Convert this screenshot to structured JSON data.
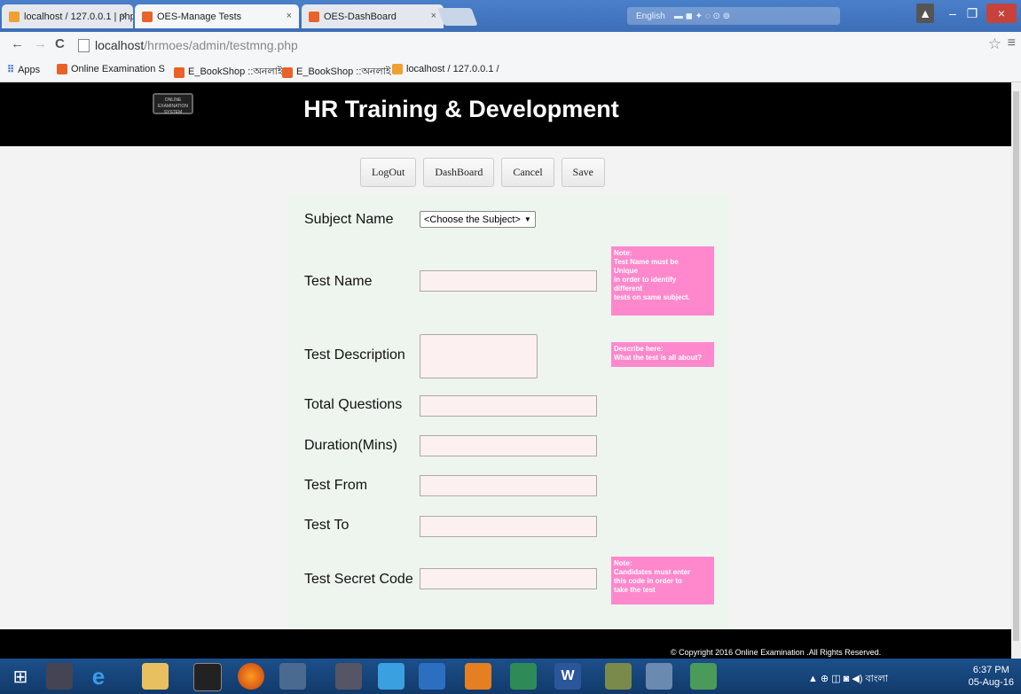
{
  "browser": {
    "tabs": [
      {
        "title": "localhost / 127.0.0.1 | php",
        "active": false
      },
      {
        "title": "OES-Manage Tests",
        "active": true
      },
      {
        "title": "OES-DashBoard",
        "active": false
      }
    ],
    "ime_label": "English",
    "address": {
      "host": "localhost",
      "path": "/hrmoes/admin/testmng.php"
    },
    "bookmarks": [
      "Apps",
      "Online Examination S",
      "E_BookShop ::অনলাই",
      "E_BookShop ::অনলাই",
      "localhost / 127.0.0.1 /"
    ]
  },
  "page": {
    "logo_text": "ONLINE EXAMINATION SYSTEM",
    "title": "HR Training & Development",
    "buttons": {
      "logout": "LogOut",
      "dashboard": "DashBoard",
      "cancel": "Cancel",
      "save": "Save"
    },
    "form": {
      "subject_label": "Subject Name",
      "subject_select": "<Choose the Subject>",
      "test_name_label": "Test Name",
      "test_description_label": "Test Description",
      "total_questions_label": "Total Questions",
      "duration_label": "Duration(Mins)",
      "test_from_label": "Test From",
      "test_to_label": "Test To",
      "secret_code_label": "Test Secret Code"
    },
    "notes": {
      "test_name_note": [
        "Note:",
        "Test Name must be",
        "Unique",
        "in order to identify",
        "different",
        "tests on same subject."
      ],
      "description_note": [
        "Describe here:",
        "What the test is all about?"
      ],
      "secret_code_note": [
        "Note:",
        "Candidates must enter",
        "this code in order to",
        "take the test"
      ]
    },
    "copyright": "© Copyright 2016 Online Examination .All Rights Reserved."
  },
  "taskbar": {
    "language": "বাংলা",
    "time": "6:37 PM",
    "date": "05-Aug-16"
  },
  "colors": {
    "header_bg": "#000000",
    "note_bg": "#ff88cc",
    "form_bg": "#eef5ee",
    "input_bg": "#fcf0f0"
  }
}
